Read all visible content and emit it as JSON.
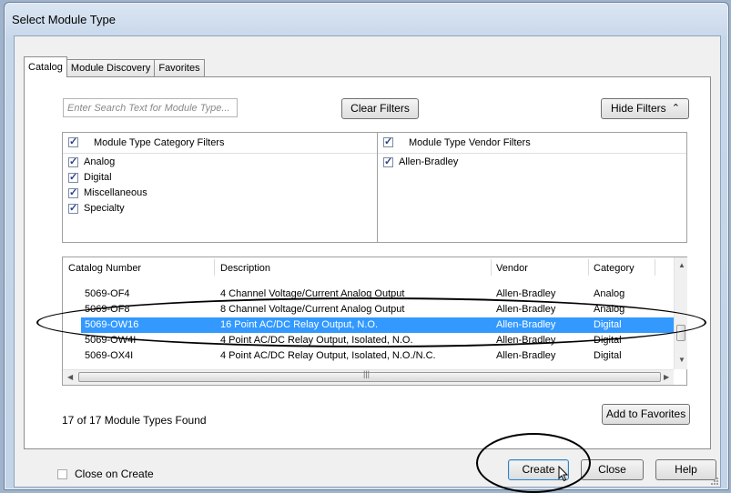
{
  "window": {
    "title": "Select Module Type"
  },
  "tabs": [
    {
      "label": "Catalog"
    },
    {
      "label": "Module Discovery"
    },
    {
      "label": "Favorites"
    }
  ],
  "search": {
    "placeholder": "Enter Search Text for Module Type..."
  },
  "buttons": {
    "clear_filters": "Clear Filters",
    "hide_filters": "Hide Filters",
    "add_to_favorites": "Add to Favorites",
    "create": "Create",
    "close": "Close",
    "help": "Help"
  },
  "category_filters": {
    "header": "Module Type Category Filters",
    "items": [
      {
        "label": "Analog",
        "checked": true
      },
      {
        "label": "Digital",
        "checked": true
      },
      {
        "label": "Miscellaneous",
        "checked": true
      },
      {
        "label": "Specialty",
        "checked": true
      }
    ]
  },
  "vendor_filters": {
    "header": "Module Type Vendor Filters",
    "items": [
      {
        "label": "Allen-Bradley",
        "checked": true
      }
    ]
  },
  "table": {
    "columns": [
      "Catalog Number",
      "Description",
      "Vendor",
      "Category"
    ],
    "rows": [
      {
        "catalog": "5069-OF4",
        "description": "4 Channel Voltage/Current Analog Output",
        "vendor": "Allen-Bradley",
        "category": "Analog"
      },
      {
        "catalog": "5069-OF8",
        "description": "8 Channel Voltage/Current Analog Output",
        "vendor": "Allen-Bradley",
        "category": "Analog"
      },
      {
        "catalog": "5069-OW16",
        "description": "16 Point AC/DC Relay Output, N.O.",
        "vendor": "Allen-Bradley",
        "category": "Digital"
      },
      {
        "catalog": "5069-OW4I",
        "description": "4 Point AC/DC Relay Output, Isolated, N.O.",
        "vendor": "Allen-Bradley",
        "category": "Digital"
      },
      {
        "catalog": "5069-OX4I",
        "description": "4 Point AC/DC Relay Output, Isolated, N.O./N.C.",
        "vendor": "Allen-Bradley",
        "category": "Digital"
      }
    ]
  },
  "status": {
    "found": "17 of 17 Module Types Found"
  },
  "close_on_create": {
    "label": "Close on Create",
    "checked": false
  },
  "icons": {
    "hide_filters": "double-chevron-up-icon",
    "check": "check-icon",
    "cursor": "mouse-pointer-icon"
  },
  "colors": {
    "selection": "#3399ff",
    "annotation": "#000000"
  }
}
